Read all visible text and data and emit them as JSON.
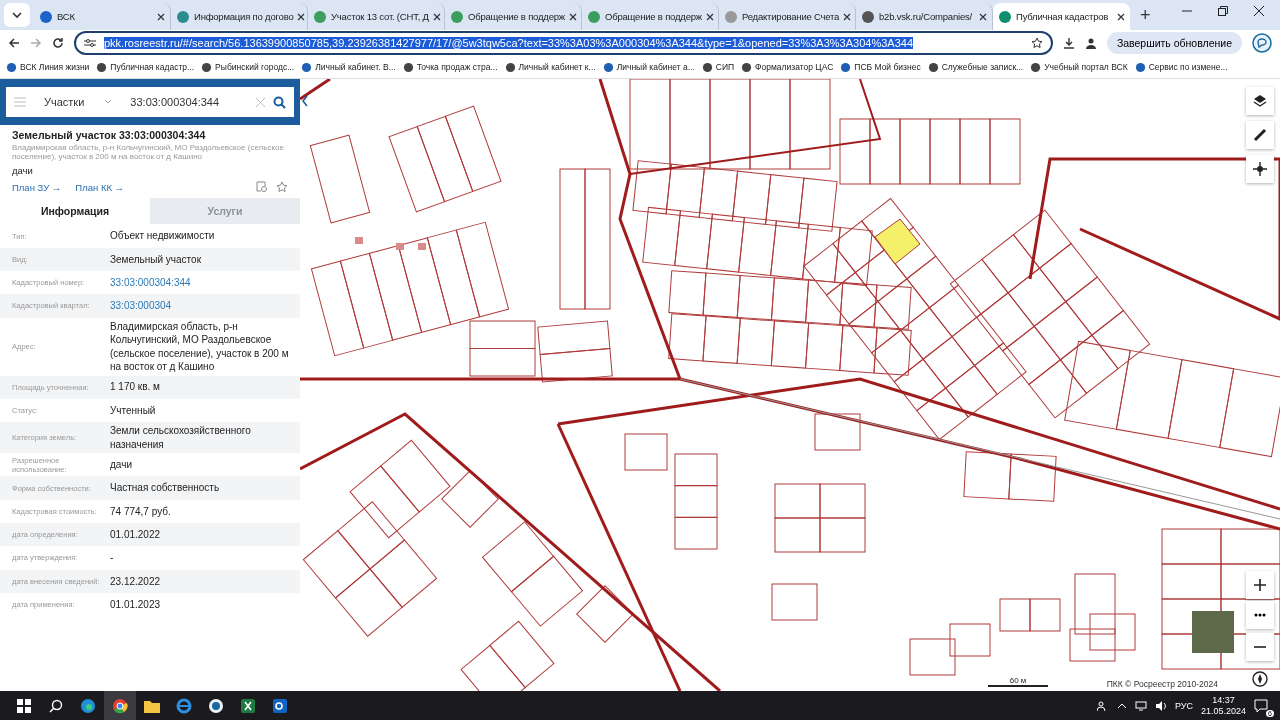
{
  "browser": {
    "tabs": [
      {
        "title": "ВСК",
        "selected": false
      },
      {
        "title": "Информация по догово",
        "selected": false
      },
      {
        "title": "Участок 13 сот. (СНТ, Д",
        "selected": false
      },
      {
        "title": "Обращение в поддерж",
        "selected": false
      },
      {
        "title": "Обращение в поддерж",
        "selected": false
      },
      {
        "title": "Редактирование Счета",
        "selected": false
      },
      {
        "title": "b2b.vsk.ru/Companies/",
        "selected": false
      },
      {
        "title": "Публичная кадастров",
        "selected": true
      }
    ],
    "new_tab": "+",
    "address": "pkk.rosreestr.ru/#/search/56.13639900850785,39.23926381427977/17/@5w3tqw5ca?text=33%3A03%3A000304%3A344&type=1&opened=33%3A3%3A304%3A344",
    "update_button": "Завершить обновление",
    "bookmarks": [
      "ВСК Линия жизни",
      "Публичная кадастр...",
      "Рыбинский городс...",
      "Личный кабинет. В...",
      "Точка продаж стра...",
      "Личный кабинет к...",
      "Личный кабинет а...",
      "СИП",
      "Формализатор ЦАС",
      "ПСБ Мой бизнес",
      "Служебные записк...",
      "Учебный портал ВСК",
      "Сервис по измене..."
    ]
  },
  "panel": {
    "search": {
      "category": "Участки",
      "value": "33:03:000304:344"
    },
    "title": "Земельный участок 33:03:000304:344",
    "address": "Владимирская область, р-н Кольчугинский, МО Раздольевское (сельское поселение), участок в 200 м на восток от д Кашино",
    "use": "дачи",
    "links": [
      "План ЗУ →",
      "План КК →"
    ],
    "tabs": [
      {
        "label": "Информация",
        "selected": true
      },
      {
        "label": "Услуги",
        "selected": false
      }
    ],
    "rows": [
      {
        "label": "Тип:",
        "value": "Объект недвижимости",
        "kind": "text"
      },
      {
        "label": "Вид:",
        "value": "Земельный участок",
        "kind": "text"
      },
      {
        "label": "Кадастровый номер:",
        "value": "33:03:000304:344",
        "kind": "link"
      },
      {
        "label": "Кадастровый квартал:",
        "value": "33:03:000304",
        "kind": "link"
      },
      {
        "label": "Адрес:",
        "value": "Владимирская область, р-н Кольчугинский, МО Раздольевское (сельское поселение), участок в 200 м на восток от д Кашино",
        "kind": "text"
      },
      {
        "label": "Площадь уточненная:",
        "value": "1 170 кв. м",
        "kind": "text"
      },
      {
        "label": "Статус:",
        "value": "Учтенный",
        "kind": "text"
      },
      {
        "label": "Категория земель:",
        "value": "Земли сельскохозяйственного назначения",
        "kind": "text"
      },
      {
        "label": "Разрешенное использование:",
        "value": "дачи",
        "kind": "text"
      },
      {
        "label": "Форма собственности:",
        "value": "Частная собственность",
        "kind": "text"
      },
      {
        "label": "Кадастровая стоимость:",
        "value": "74 774,7 руб.",
        "kind": "text"
      },
      {
        "label": "дата определения:",
        "value": "01.01.2022",
        "kind": "text"
      },
      {
        "label": "дата утверждения:",
        "value": "-",
        "kind": "text"
      },
      {
        "label": "дата внесения сведений:",
        "value": "23.12.2022",
        "kind": "text"
      },
      {
        "label": "дата применения:",
        "value": "01.01.2023",
        "kind": "text"
      }
    ]
  },
  "map": {
    "scale": "60 м",
    "copyright": "ПКК © Росреестр 2010-2024"
  },
  "taskbar": {
    "language": "РУС",
    "time": "14:37",
    "date": "21.05.2024",
    "notifications": "6"
  }
}
